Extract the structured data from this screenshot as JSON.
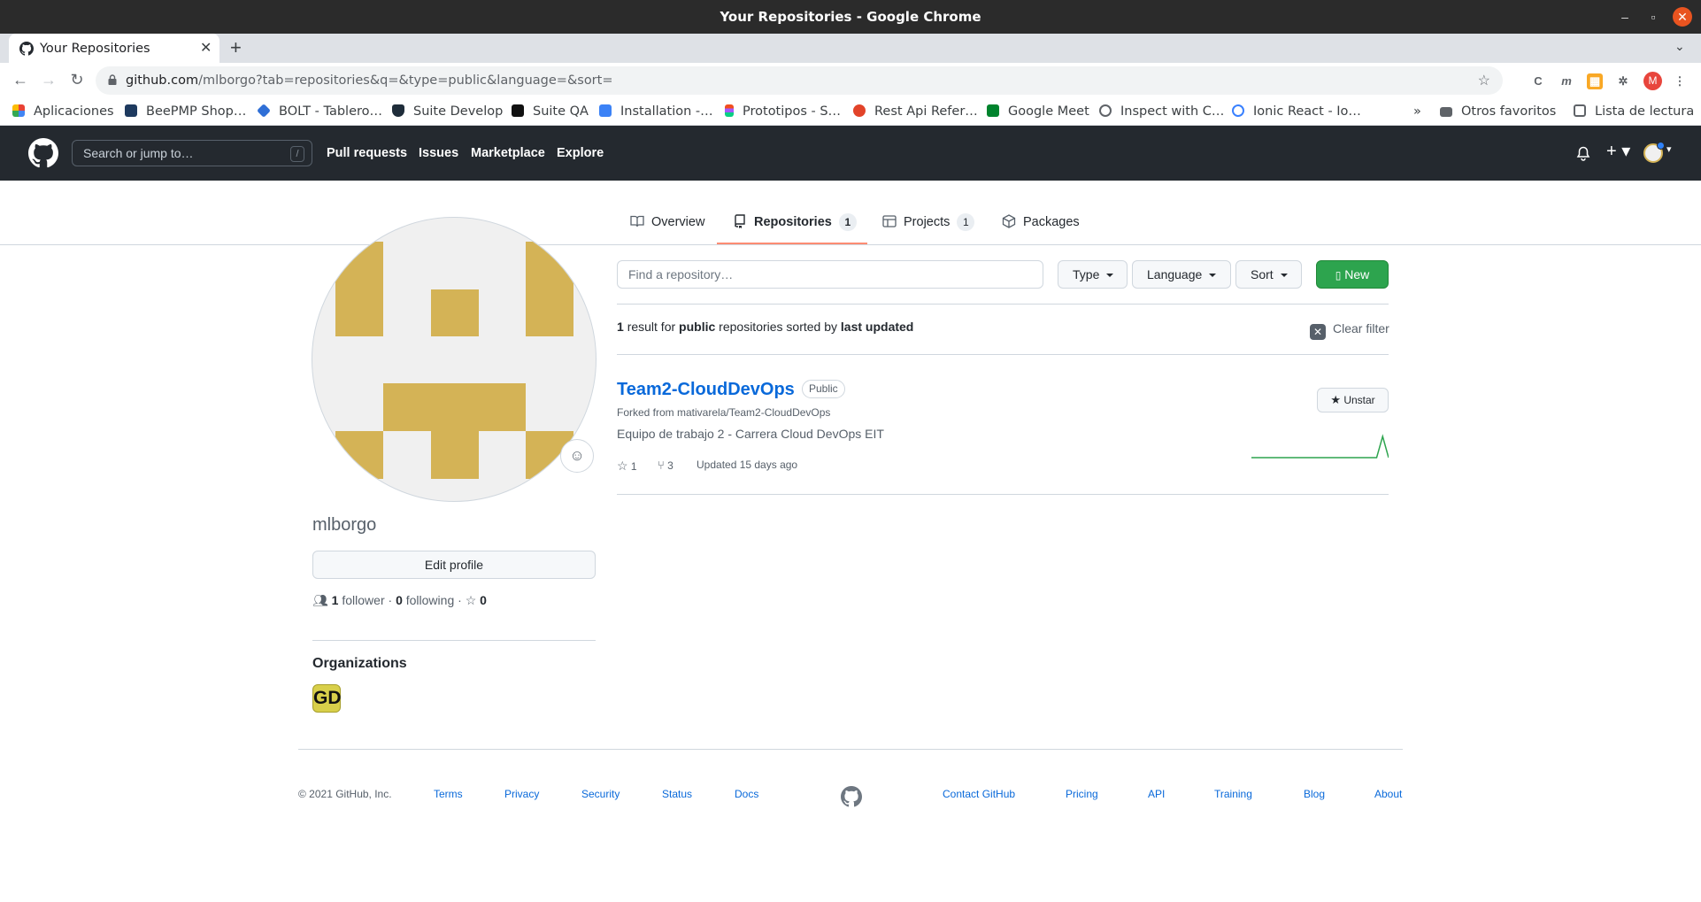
{
  "window": {
    "title": "Your Repositories - Google Chrome"
  },
  "browser": {
    "tab_title": "Your Repositories",
    "url_host": "github.com",
    "url_path": "/mlborgo?tab=repositories&q=&type=public&language=&sort=",
    "profile_initial": "M",
    "bookmarks": [
      {
        "label": "Aplicaciones",
        "icon": "apps-grid-icon",
        "color": "#e94235"
      },
      {
        "label": "BeePMP Shop…",
        "icon": "react-icon",
        "color": "#1e3a5f"
      },
      {
        "label": "BOLT - Tablero…",
        "icon": "bolt-diamond-icon",
        "color": "#2f6fd6"
      },
      {
        "label": "Suite Develop",
        "icon": "shield-icon",
        "color": "#1f2d3a"
      },
      {
        "label": "Suite QA",
        "icon": "terminal-icon",
        "color": "#111111"
      },
      {
        "label": "Installation -…",
        "icon": "capacitor-icon",
        "color": "#3b82f6"
      },
      {
        "label": "Prototipos - S…",
        "icon": "figma-icon",
        "color": "#f24e1e"
      },
      {
        "label": "Rest Api Refer…",
        "icon": "gitlab-icon",
        "color": "#e24329"
      },
      {
        "label": "Google Meet",
        "icon": "meet-icon",
        "color": "#00832d"
      },
      {
        "label": "Inspect with C…",
        "icon": "globe-icon",
        "color": "#5f6368"
      },
      {
        "label": "Ionic React - Io…",
        "icon": "ionic-icon",
        "color": "#3880ff"
      }
    ],
    "more_bookmarks": "»",
    "other_favorites": "Otros favoritos",
    "reading_list": "Lista de lectura"
  },
  "github_header": {
    "search_placeholder": "Search or jump to…",
    "search_shortcut": "/",
    "nav": [
      "Pull requests",
      "Issues",
      "Marketplace",
      "Explore"
    ]
  },
  "profile_tabs": [
    {
      "label": "Overview",
      "count": null
    },
    {
      "label": "Repositories",
      "count": "1"
    },
    {
      "label": "Projects",
      "count": "1"
    },
    {
      "label": "Packages",
      "count": null
    }
  ],
  "profile": {
    "username": "mlborgo",
    "edit_label": "Edit profile",
    "followers_count": "1",
    "followers_label": "follower",
    "following_count": "0",
    "following_label": "following",
    "stars_count": "0",
    "orgs_title": "Organizations",
    "org_initials": "GD",
    "avatar_color": "#d4b356"
  },
  "repo_filters": {
    "find_placeholder": "Find a repository…",
    "type_label": "Type",
    "language_label": "Language",
    "sort_label": "Sort",
    "new_label": "New",
    "result_count": "1",
    "result_for": "result for",
    "result_type": "public",
    "result_mid": "repositories sorted by",
    "result_sort": "last updated",
    "clear_label": "Clear filter"
  },
  "repos": [
    {
      "name": "Team2-CloudDevOps",
      "visibility": "Public",
      "forked_from": "Forked from mativarela/Team2-CloudDevOps",
      "description": "Equipo de trabajo 2 - Carrera Cloud DevOps EIT",
      "stars": "1",
      "forks": "3",
      "updated": "Updated 15 days ago",
      "unstar_label": "Unstar",
      "activity": [
        0,
        0,
        0,
        0,
        0,
        0,
        0,
        0,
        0,
        0,
        0,
        0,
        0,
        0,
        0,
        0,
        0,
        0,
        0,
        0,
        0,
        0,
        1,
        0
      ]
    }
  ],
  "footer": {
    "copyright": "© 2021 GitHub, Inc.",
    "links_left": [
      "Terms",
      "Privacy",
      "Security",
      "Status",
      "Docs"
    ],
    "links_right": [
      "Contact GitHub",
      "Pricing",
      "API",
      "Training",
      "Blog",
      "About"
    ]
  },
  "colors": {
    "header_bg": "#24292f",
    "new_button": "#2da44e",
    "link": "#0969da",
    "active_tab_underline": "#fd8c73",
    "sparkline": "#2da44e"
  }
}
